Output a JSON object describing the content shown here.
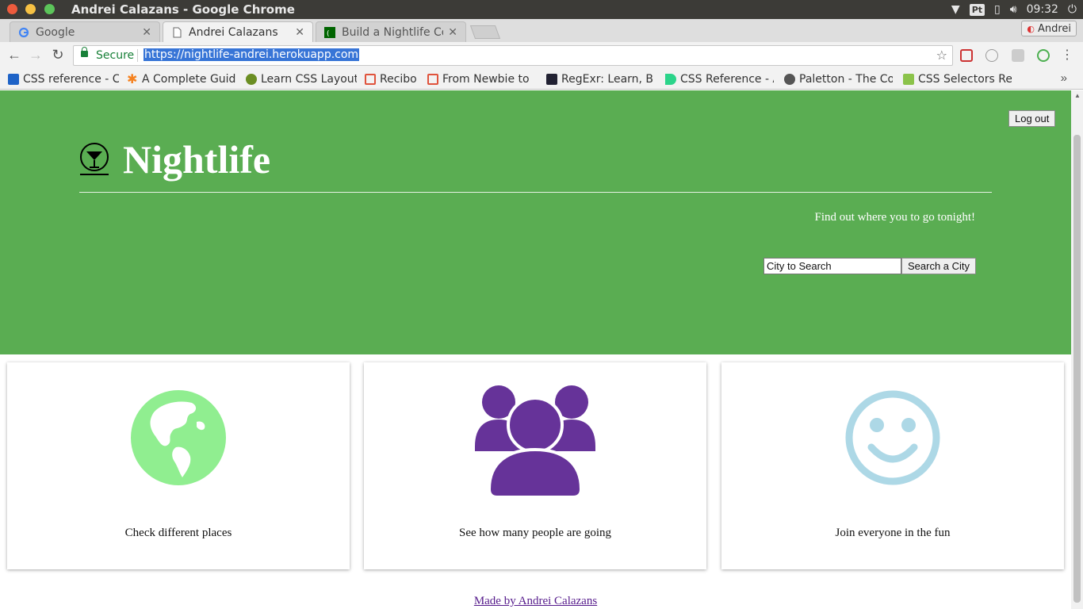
{
  "os": {
    "window_title": "Andrei Calazans - Google Chrome",
    "lang": "Pt",
    "clock": "09:32"
  },
  "tabs": [
    {
      "label": "Google",
      "icon": "google-icon",
      "active": false
    },
    {
      "label": "Andrei Calazans",
      "icon": "page-icon",
      "active": true
    },
    {
      "label": "Build a Nightlife Co",
      "icon": "fcc-icon",
      "active": false
    }
  ],
  "profile": {
    "name": "Andrei"
  },
  "omnibox": {
    "secure_label": "Secure",
    "url": "https://nightlife-andrei.herokuapp.com"
  },
  "bookmarks": [
    {
      "label": "CSS reference - C",
      "icon_color": "#1e63c7"
    },
    {
      "label": "A Complete Guid",
      "icon_color": "#f58220"
    },
    {
      "label": "Learn CSS Layout",
      "icon_color": "#6b8e23"
    },
    {
      "label": "Recibo",
      "icon_color": "#e0533c"
    },
    {
      "label": "From Newbie to",
      "icon_color": "#e0533c"
    },
    {
      "label": "RegExr: Learn, B",
      "icon_color": "#222233"
    },
    {
      "label": "CSS Reference - A",
      "icon_color": "#2bd48a"
    },
    {
      "label": "Paletton - The Co",
      "icon_color": "#555555"
    },
    {
      "label": "CSS Selectors Ref",
      "icon_color": "#8bc34a"
    }
  ],
  "header": {
    "logout_label": "Log out",
    "brand_title": "Nightlife",
    "tagline": "Find out where you to go tonight!",
    "search_value": "City to Search",
    "search_button": "Search a City",
    "bg_color": "#5aad52"
  },
  "features": [
    {
      "caption": "Check different places",
      "icon": "globe-icon",
      "color": "#90ee90"
    },
    {
      "caption": "See how many people are going",
      "icon": "people-group-icon",
      "color": "#663399"
    },
    {
      "caption": "Join everyone in the fun",
      "icon": "smiley-icon",
      "color": "#add8e6"
    }
  ],
  "footer": {
    "link": "Made by Andrei Calazans"
  }
}
